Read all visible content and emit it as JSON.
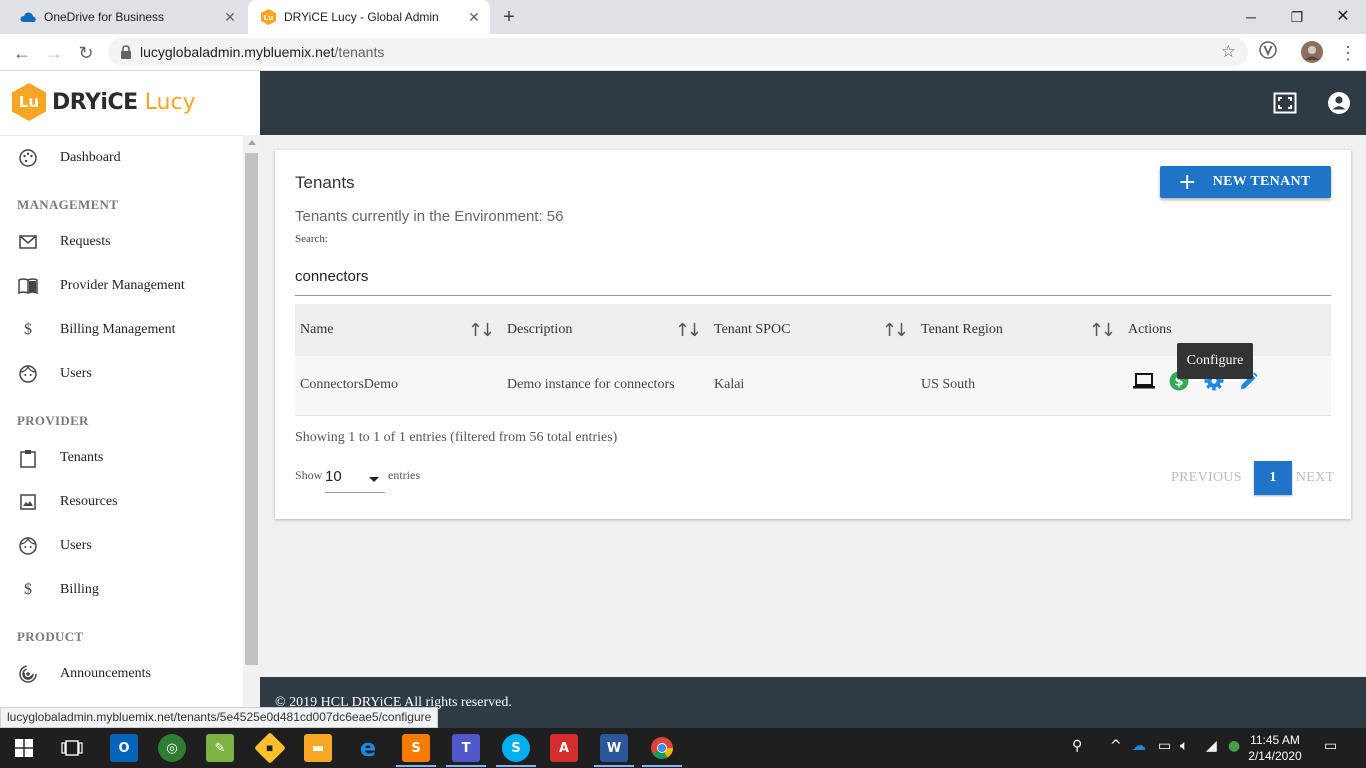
{
  "browser": {
    "tabs": [
      {
        "title": "OneDrive for Business",
        "icon": "onedrive-icon",
        "active": false
      },
      {
        "title": "DRYiCE Lucy - Global Admin",
        "icon": "lucy-favicon",
        "active": true
      }
    ],
    "url_host": "lucyglobaladmin.mybluemix.net",
    "url_path": "/tenants",
    "status_url": "lucyglobaladmin.mybluemix.net/tenants/5e4525e0d481cd007dc6eae5/configure"
  },
  "app": {
    "logo_mark": "Lu",
    "brand_main": "DRYiCE",
    "brand_sub": "Lucy",
    "accent": "#f5a623",
    "header_bg": "#2e3a44",
    "primary": "#1e74c6"
  },
  "sidebar": {
    "items": [
      {
        "label": "Dashboard",
        "icon": "palette-icon"
      },
      {
        "section": "MANAGEMENT"
      },
      {
        "label": "Requests",
        "icon": "mail-icon"
      },
      {
        "label": "Provider Management",
        "icon": "book-icon"
      },
      {
        "label": "Billing Management",
        "icon": "dollar-icon"
      },
      {
        "label": "Users",
        "icon": "face-icon"
      },
      {
        "section": "PROVIDER"
      },
      {
        "label": "Tenants",
        "icon": "clipboard-icon"
      },
      {
        "label": "Resources",
        "icon": "image-icon"
      },
      {
        "label": "Users",
        "icon": "face-icon"
      },
      {
        "label": "Billing",
        "icon": "dollar-icon"
      },
      {
        "section": "PRODUCT"
      },
      {
        "label": "Announcements",
        "icon": "rss-icon"
      }
    ]
  },
  "page": {
    "title": "Tenants",
    "subtitle": "Tenants currently in the Environment: 56",
    "new_button": "NEW TENANT",
    "search_label": "Search:",
    "search_value": "connectors",
    "columns": [
      "Name",
      "Description",
      "Tenant SPOC",
      "Tenant Region",
      "Actions"
    ],
    "rows": [
      {
        "name": "ConnectorsDemo",
        "description": "Demo instance for connectors",
        "spoc": "Kalai",
        "region": "US South"
      }
    ],
    "action_icons": [
      "laptop-icon",
      "dollar-circle-icon",
      "gear-icon",
      "pencil-icon"
    ],
    "tooltip": "Configure",
    "showing": "Showing 1 to 1 of 1 entries (filtered from 56 total entries)",
    "length_show": "Show",
    "length_value": "10",
    "length_entries": "entries",
    "pager": {
      "previous": "PREVIOUS",
      "page": "1",
      "next": "NEXT"
    }
  },
  "footer": {
    "copyright": "© 2019 HCL DRYiCE All rights reserved."
  },
  "taskbar": {
    "time": "11:45 AM",
    "date": "2/14/2020"
  }
}
